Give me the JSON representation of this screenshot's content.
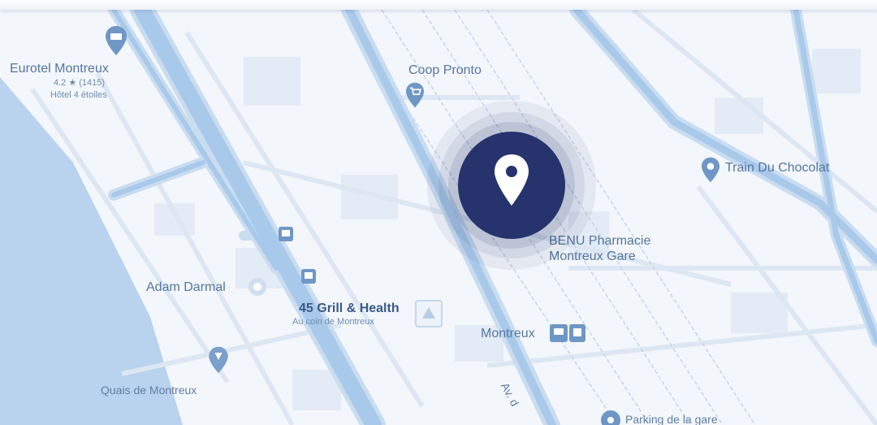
{
  "map": {
    "colors": {
      "background": "#f3f6fb",
      "water": "#b9d2ee",
      "road": "#a9c9ea",
      "road_casing": "#c9dcf0",
      "block": "#e3ebf6",
      "label": "#5f7fa5",
      "marker": "#26336d"
    },
    "places": {
      "eurotel": {
        "name": "Eurotel Montreux",
        "rating": "4.2 ★ (1415)",
        "category": "Hôtel 4 étoiles",
        "icon": "hotel-icon"
      },
      "coop": {
        "name": "Coop Pronto",
        "icon": "shopping-cart-icon"
      },
      "train_chocolat": {
        "name": "Train Du Chocolat",
        "icon": "pin-icon"
      },
      "benu": {
        "line1": "BENU Pharmacie",
        "line2": "Montreux Gare"
      },
      "adam": {
        "name": "Adam Darmal",
        "icon": "clinic-icon"
      },
      "grill": {
        "name": "45 Grill & Health",
        "sub": "Au coin de Montreux",
        "icon": "building-icon"
      },
      "station": {
        "name": "Montreux",
        "icon": "train-icon"
      },
      "quais": {
        "name": "Quais de Montreux",
        "icon": "landmark-icon"
      },
      "parking": {
        "name": "Parking de la gare",
        "icon": "parking-icon"
      },
      "avenue": {
        "name": "Av. d"
      }
    },
    "marker": {
      "icon": "location-pin-icon"
    }
  }
}
